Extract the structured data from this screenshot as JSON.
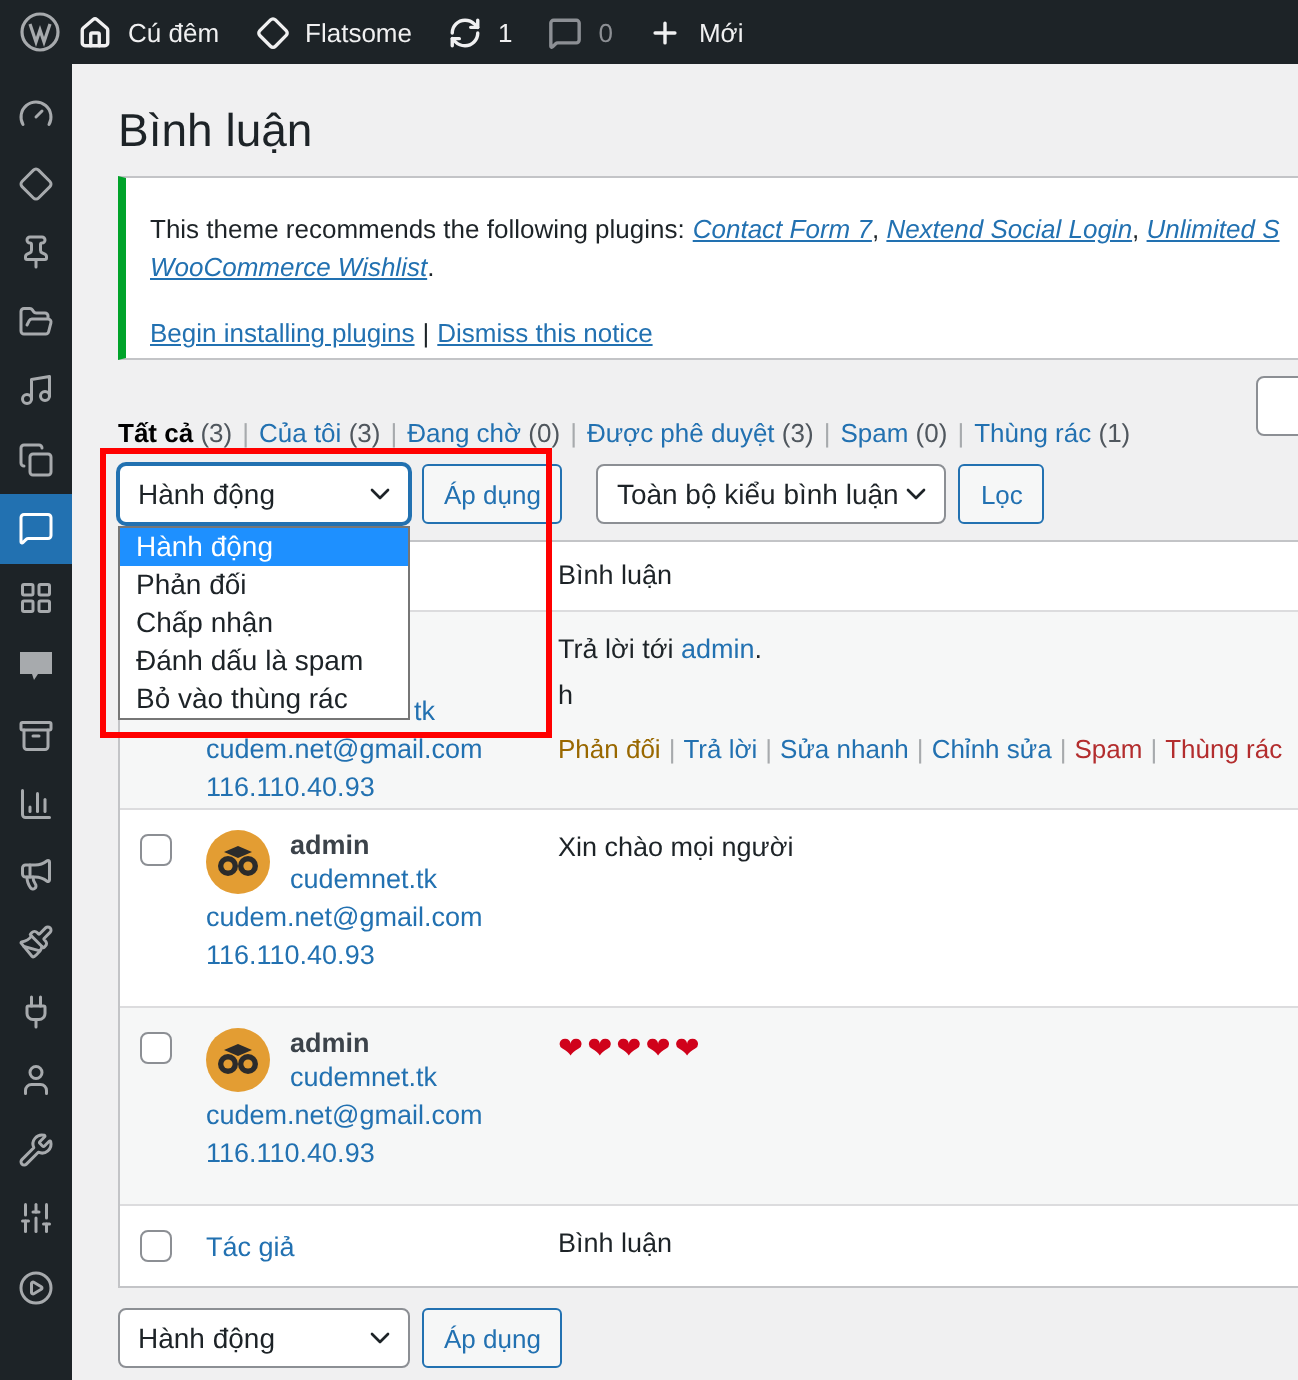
{
  "admin_bar": {
    "items": [
      {
        "kind": "home",
        "label": "Cú đêm"
      },
      {
        "kind": "theme",
        "label": "Flatsome"
      },
      {
        "kind": "updates",
        "label": "1"
      },
      {
        "kind": "comments",
        "label": "0"
      },
      {
        "kind": "new",
        "label": "Mới"
      }
    ]
  },
  "sidebar": {
    "items": [
      {
        "kind": "dashboard",
        "selected": false
      },
      {
        "kind": "theme",
        "selected": false
      },
      {
        "kind": "posts",
        "selected": false
      },
      {
        "kind": "media",
        "selected": false
      },
      {
        "kind": "music",
        "selected": false
      },
      {
        "kind": "pages",
        "selected": false
      },
      {
        "kind": "comments",
        "selected": true
      },
      {
        "kind": "blocks",
        "selected": false
      },
      {
        "kind": "woo",
        "selected": false
      },
      {
        "kind": "products",
        "selected": false
      },
      {
        "kind": "analytics",
        "selected": false
      },
      {
        "kind": "marketing",
        "selected": false
      },
      {
        "kind": "appearance",
        "selected": false
      },
      {
        "kind": "plugins",
        "selected": false
      },
      {
        "kind": "users",
        "selected": false
      },
      {
        "kind": "tools",
        "selected": false
      },
      {
        "kind": "settings",
        "selected": false
      },
      {
        "kind": "media_player",
        "selected": false
      }
    ]
  },
  "page_title": "Bình luận",
  "notice": {
    "lines": [
      [
        {
          "text": "This theme recommends the following plugins:",
          "link": false
        },
        {
          "text": "Contact Form 7",
          "link": true,
          "after": ", "
        },
        {
          "text": "Nextend Social Login",
          "link": true,
          "after": ", "
        },
        {
          "text": "Unlimited S",
          "link": true
        }
      ],
      [
        {
          "text": "WooCommerce Wishlist",
          "link": true,
          "after": "."
        }
      ]
    ],
    "actions": [
      "Begin installing plugins",
      "Dismiss this notice"
    ],
    "separator": "|"
  },
  "filters": [
    {
      "label": "Tất cả",
      "count": "(3)",
      "selected": true
    },
    {
      "label": "Của tôi",
      "count": "(3)",
      "selected": false
    },
    {
      "label": "Đang chờ",
      "count": "(0)",
      "selected": false
    },
    {
      "label": "Được phê duyệt",
      "count": "(3)",
      "selected": false
    },
    {
      "label": "Spam",
      "count": "(0)",
      "selected": false
    },
    {
      "label": "Thùng rác",
      "count": "(1)",
      "selected": false
    }
  ],
  "filter_separator": "|",
  "bulk_action": {
    "value": "Hành động",
    "expanded": true,
    "options": [
      {
        "label": "Hành động",
        "selected": true
      },
      {
        "label": "Phản đối",
        "selected": false
      },
      {
        "label": "Chấp nhận",
        "selected": false
      },
      {
        "label": "Đánh dấu là spam",
        "selected": false
      },
      {
        "label": "Bỏ vào thùng rác",
        "selected": false
      }
    ]
  },
  "apply_button": "Áp dụng",
  "type_filter": {
    "value": "Toàn bộ kiểu bình luận"
  },
  "filter_button": "Lọc",
  "table": {
    "header": {
      "column_2": "Bình luận"
    },
    "action_separator": "|",
    "rows": [
      {
        "author": {
          "url": "tk",
          "email": "cudem.net@gmail.com",
          "ip": "116.110.40.93"
        },
        "comment": {
          "reply_prefix": "Trả lời tới ",
          "reply_to": "admin",
          "reply_suffix": ".",
          "text": "h"
        },
        "actions": [
          {
            "label": "Phản đối",
            "kind": "unapprove"
          },
          {
            "label": "Trả lời",
            "kind": "normal"
          },
          {
            "label": "Sửa nhanh",
            "kind": "normal"
          },
          {
            "label": "Chỉnh sửa",
            "kind": "normal"
          },
          {
            "label": "Spam",
            "kind": "danger"
          },
          {
            "label": "Thùng rác",
            "kind": "danger"
          }
        ]
      },
      {
        "checked": false,
        "author": {
          "name": "admin",
          "url": "cudemnet.tk",
          "email": "cudem.net@gmail.com",
          "ip": "116.110.40.93"
        },
        "comment": {
          "text": "Xin chào mọi người"
        }
      },
      {
        "checked": false,
        "author": {
          "name": "admin",
          "url": "cudemnet.tk",
          "email": "cudem.net@gmail.com",
          "ip": "116.110.40.93"
        },
        "comment": {
          "text": "❤❤❤❤❤"
        }
      }
    ],
    "footer": {
      "checked": false,
      "column_1": "Tác giả",
      "column_2": "Bình luận"
    }
  },
  "bottom_bulk_action": {
    "value": "Hành động"
  },
  "bottom_apply_button": "Áp dụng"
}
